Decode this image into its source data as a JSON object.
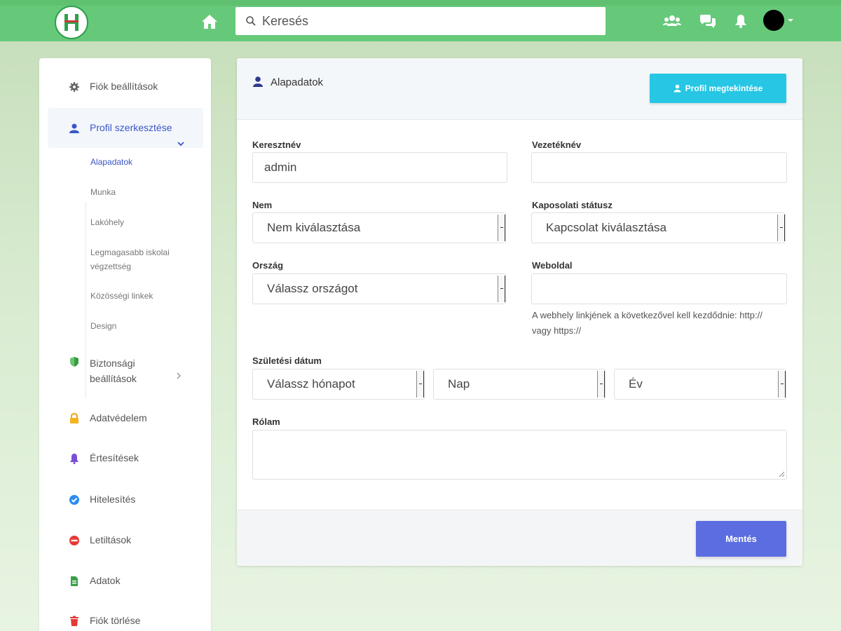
{
  "header": {
    "logo_letter": "H",
    "search_placeholder": "Keresés",
    "icons": [
      "home-icon",
      "search-icon",
      "users-icon",
      "chat-icon",
      "bell-icon",
      "avatar",
      "caret-down-icon"
    ]
  },
  "sidebar": {
    "items": [
      {
        "label": "Fiók beállítások",
        "icon": "gear-icon"
      },
      {
        "label": "Profil szerkesztése",
        "icon": "user-icon"
      },
      {
        "label": "Biztonsági beállítások",
        "icon": "shield-icon"
      },
      {
        "label": "Adatvédelem",
        "icon": "lock-icon"
      },
      {
        "label": "Értesítések",
        "icon": "bell-icon"
      },
      {
        "label": "Hitelesítés",
        "icon": "check-circle-icon"
      },
      {
        "label": "Letiltások",
        "icon": "block-icon"
      },
      {
        "label": "Adatok",
        "icon": "file-icon"
      },
      {
        "label": "Fiók törlése",
        "icon": "trash-icon"
      }
    ],
    "subitems": [
      "Alapadatok",
      "Munka",
      "Lakóhely",
      "Legmagasabb iskolai végzettség",
      "Közösségi linkek",
      "Design"
    ]
  },
  "card": {
    "title": "Alapadatok",
    "view_profile_label": "Profil megtekintése",
    "fields": {
      "firstname_label": "Keresztnév",
      "firstname_value": "admin",
      "lastname_label": "Vezetéknév",
      "lastname_value": "",
      "gender_label": "Nem",
      "gender_value": "Nem kiválasztása",
      "relationship_label": "Kaposolati státusz",
      "relationship_value": "Kapcsolat kiválasztása",
      "country_label": "Ország",
      "country_value": "Válassz országot",
      "website_label": "Weboldal",
      "website_value": "",
      "website_hint": "A webhely linkjének a következővel kell kezdődnie: http:// vagy https://",
      "birth_label": "Születési dátum",
      "birth_month": "Válassz hónapot",
      "birth_day": "Nap",
      "birth_year": "Év",
      "about_label": "Rólam",
      "about_value": ""
    },
    "save_label": "Mentés"
  },
  "colors": {
    "topbar": "#66c97a",
    "accent_blue": "#3b56c7",
    "view_button": "#26c6e4",
    "save_button": "#5b6de0"
  }
}
